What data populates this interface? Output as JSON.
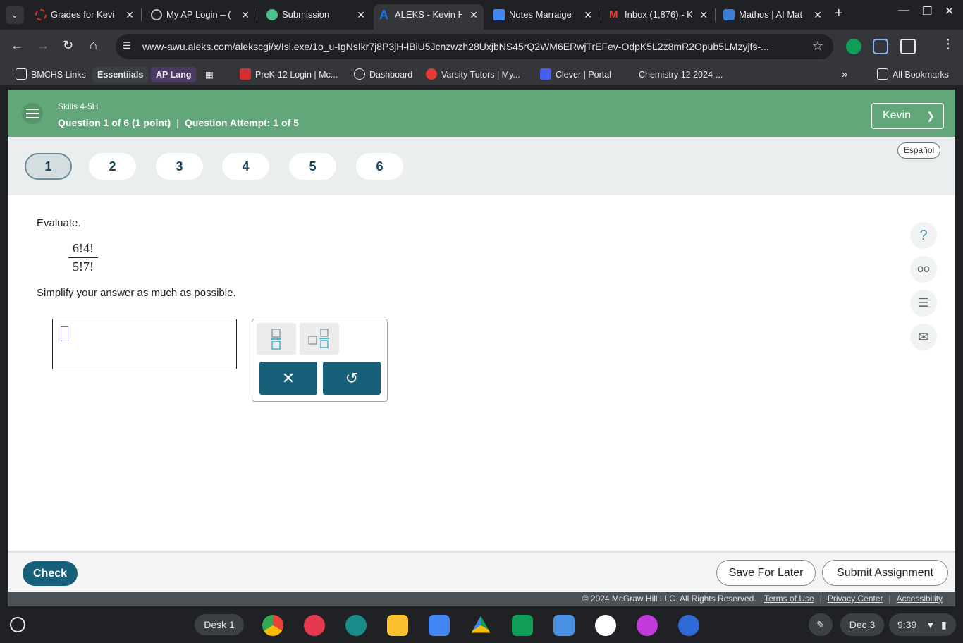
{
  "browser": {
    "tabs": [
      {
        "title": "Grades for Kevi",
        "active": false
      },
      {
        "title": "My AP Login – (",
        "active": false
      },
      {
        "title": "Submission",
        "active": false
      },
      {
        "title": "ALEKS - Kevin H",
        "active": true
      },
      {
        "title": "Notes Marraige",
        "active": false
      },
      {
        "title": "Inbox (1,876) - K",
        "active": false
      },
      {
        "title": "Mathos | AI Mat",
        "active": false
      }
    ],
    "url": "www-awu.aleks.com/alekscgi/x/Isl.exe/1o_u-IgNsIkr7j8P3jH-lBiU5Jcnzwzh28UxjbNS45rQ2WM6ERwjTrEFev-OdpK5L2z8mR2Opub5LMzyjfs-...",
    "bookmarks": [
      "BMCHS Links",
      "Essentiials",
      "AP Lang",
      "PreK-12 Login | Mc...",
      "Dashboard",
      "Varsity Tutors | My...",
      "Clever | Portal",
      "Chemistry 12 2024-...",
      "All Bookmarks"
    ]
  },
  "aleks": {
    "section": "Skills 4-5H",
    "question_info": "Question 1 of 6 (1 point)",
    "attempt_info": "Question Attempt: 1 of 5",
    "separator": "|",
    "user": "Kevin",
    "language": "Español",
    "questions": [
      "1",
      "2",
      "3",
      "4",
      "5",
      "6"
    ],
    "current_question": "1",
    "prompt": "Evaluate.",
    "numerator": "6!4!",
    "denominator": "5!7!",
    "instruction": "Simplify your answer as much as possible.",
    "check_label": "Check",
    "save_label": "Save For Later",
    "submit_label": "Submit Assignment",
    "copyright": "© 2024 McGraw Hill LLC. All Rights Reserved.",
    "terms": "Terms of Use",
    "privacy": "Privacy Center",
    "accessibility": "Accessibility",
    "legal_sep": "|"
  },
  "shelf": {
    "desk": "Desk 1",
    "date": "Dec 3",
    "time": "9:39"
  },
  "colors": {
    "header_green": "#62a77a",
    "primary_teal": "#17607a"
  }
}
